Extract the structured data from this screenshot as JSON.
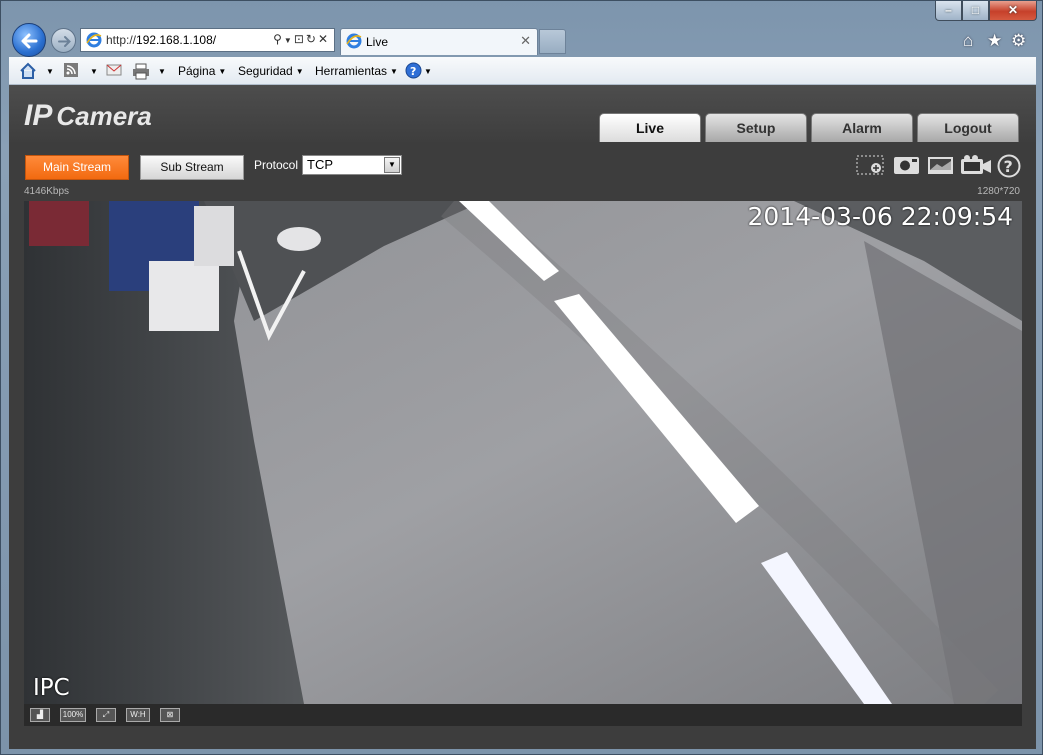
{
  "browser": {
    "address_url_prefix": "http://",
    "address_url_host": "192.168.1.108/",
    "tab_title": "Live",
    "menu": [
      {
        "label": "Página"
      },
      {
        "label": "Seguridad"
      },
      {
        "label": "Herramientas"
      }
    ]
  },
  "app": {
    "brand_ip": "IP",
    "brand_camera": "Camera",
    "nav_tabs": [
      {
        "label": "Live",
        "active": true
      },
      {
        "label": "Setup"
      },
      {
        "label": "Alarm"
      },
      {
        "label": "Logout"
      }
    ],
    "main_stream_label": "Main Stream",
    "sub_stream_label": "Sub Stream",
    "protocol_label": "Protocol",
    "protocol_value": "TCP",
    "bitrate": "4146Kbps",
    "resolution": "1280*720"
  },
  "video": {
    "timestamp": "2014-03-06 22:09:54",
    "channel_name": "IPC"
  },
  "video_controls": {
    "zoom_100_label": "100%",
    "wh_label": "W:H"
  },
  "colors": {
    "accent_orange": "#f26a10",
    "page_bg": "#3d3d3d"
  }
}
